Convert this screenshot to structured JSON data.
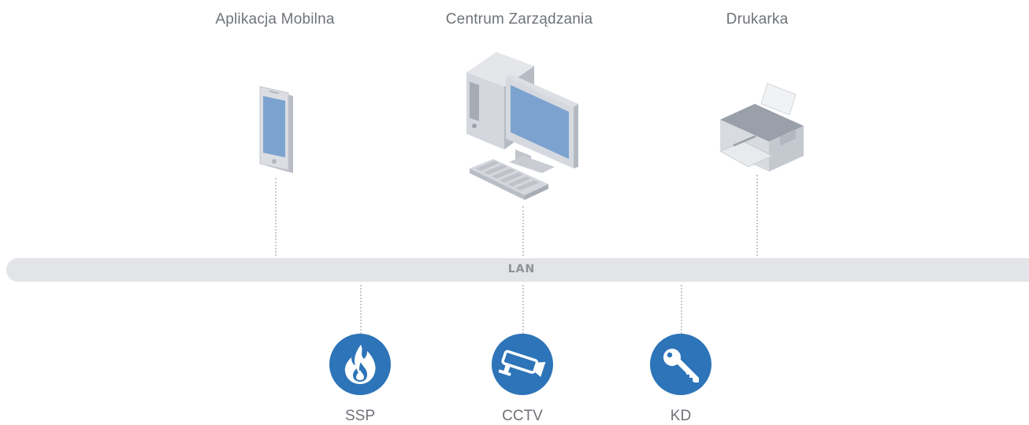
{
  "top_nodes": [
    {
      "label": "Aplikacja Mobilna",
      "icon": "smartphone-icon"
    },
    {
      "label": "Centrum Zarządzania",
      "icon": "desktop-computer-icon"
    },
    {
      "label": "Drukarka",
      "icon": "printer-icon"
    }
  ],
  "network": {
    "label": "LAN"
  },
  "bottom_nodes": [
    {
      "label": "SSP",
      "icon": "fire-icon"
    },
    {
      "label": "CCTV",
      "icon": "cctv-camera-icon"
    },
    {
      "label": "KD",
      "icon": "key-icon"
    }
  ],
  "colors": {
    "accent": "#2d74b8",
    "network_bar": "#e3e4e7",
    "label_text": "#6f7378",
    "connector": "#c7c9cd",
    "screen": "#7ca3cf"
  }
}
